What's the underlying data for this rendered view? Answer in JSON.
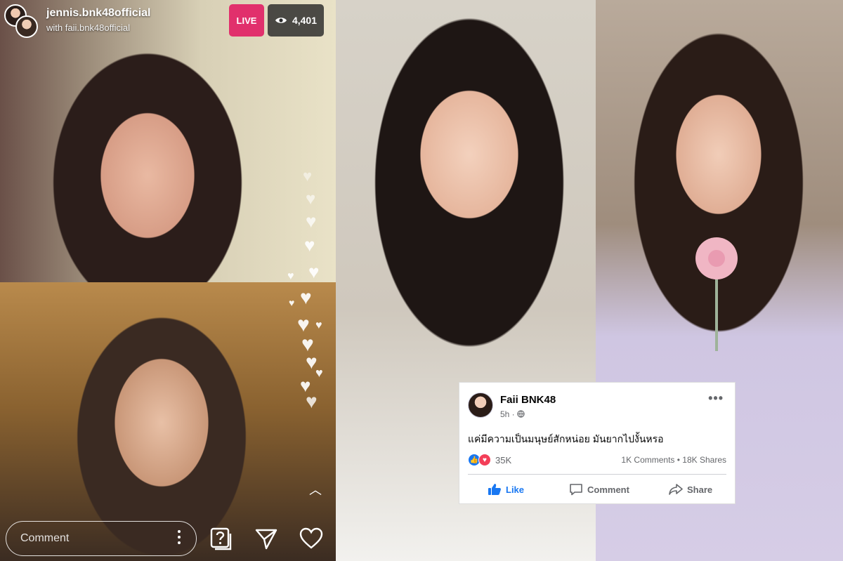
{
  "instagram_live": {
    "host_username": "jennis.bnk48official",
    "guest_line": "with faii.bnk48official",
    "live_label": "LIVE",
    "viewer_count": "4,401",
    "comment_placeholder": "Comment",
    "icons": [
      "eye-icon",
      "more-vertical-icon",
      "question-box-icon",
      "send-icon",
      "heart-icon",
      "chevron-up-icon"
    ]
  },
  "facebook_post": {
    "author": "Faii BNK48",
    "time": "5h · ",
    "text": "แค่มีความเป็นมนุษย์สักหน่อย มันยากไปงั้นหรอ",
    "reactions_count": "35K",
    "comments_shares": "1K Comments • 18K Shares",
    "like_label": "Like",
    "comment_label": "Comment",
    "share_label": "Share",
    "colors": {
      "like_blue": "#1877f2",
      "love_red": "#f33e58"
    }
  }
}
